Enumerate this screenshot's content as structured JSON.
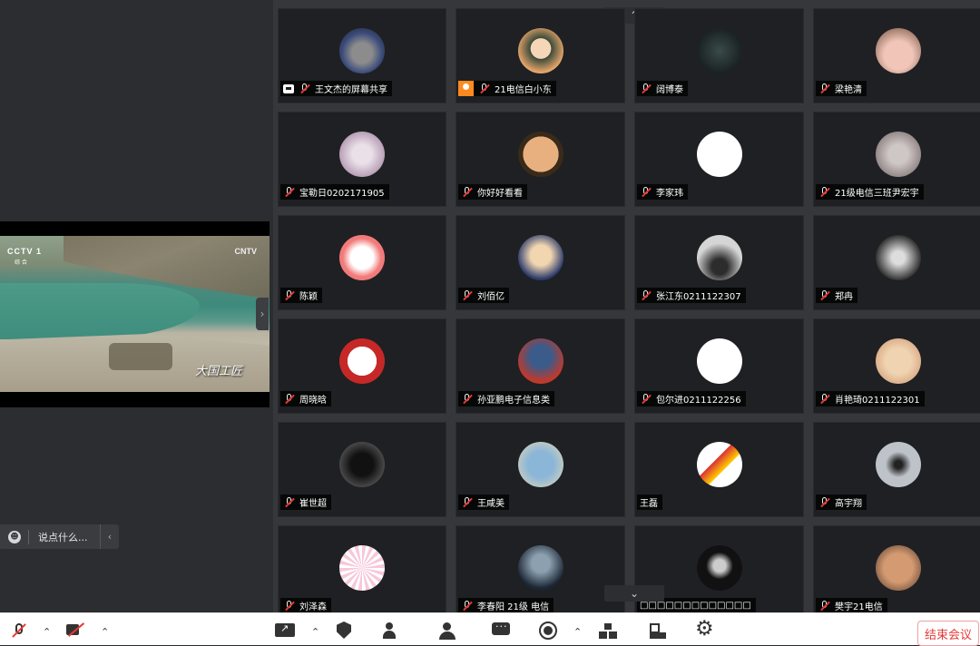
{
  "screen_share": {
    "channel_logo": "CCTV 1",
    "channel_sub": "综 合",
    "cntv_logo": "CNTV",
    "caption": "大国工匠"
  },
  "chat_input": {
    "placeholder": "说点什么..."
  },
  "participants": [
    {
      "name": "王文杰的屏幕共享",
      "indicator": "screen-share",
      "muted": true,
      "avatar": "cat"
    },
    {
      "name": "21电信白小东",
      "indicator": "camera-orange",
      "muted": true,
      "avatar": "boy"
    },
    {
      "name": "阔博泰",
      "indicator": "",
      "muted": true,
      "avatar": "dark"
    },
    {
      "name": "梁艳清",
      "indicator": "",
      "muted": true,
      "avatar": "baby"
    },
    {
      "name": "宝勒日0202171905",
      "indicator": "",
      "muted": true,
      "avatar": "girl"
    },
    {
      "name": "你好好看看",
      "indicator": "",
      "muted": true,
      "avatar": "face"
    },
    {
      "name": "李家玮",
      "indicator": "",
      "muted": true,
      "avatar": "line"
    },
    {
      "name": "21级电信三班尹宏宇",
      "indicator": "",
      "muted": true,
      "avatar": "grey"
    },
    {
      "name": "陈颖",
      "indicator": "",
      "muted": true,
      "avatar": "panda"
    },
    {
      "name": "刘佰亿",
      "indicator": "",
      "muted": true,
      "avatar": "anime"
    },
    {
      "name": "张江东0211122307",
      "indicator": "",
      "muted": true,
      "avatar": "birds"
    },
    {
      "name": "郑冉",
      "indicator": "",
      "muted": true,
      "avatar": "bw"
    },
    {
      "name": "周晓晗",
      "indicator": "",
      "muted": true,
      "avatar": "red"
    },
    {
      "name": "孙亚鹏电子信息类",
      "indicator": "",
      "muted": true,
      "avatar": "flower"
    },
    {
      "name": "包尔进0211122256",
      "indicator": "",
      "muted": true,
      "avatar": "white"
    },
    {
      "name": "肖艳琦0211122301",
      "indicator": "",
      "muted": true,
      "avatar": "beige"
    },
    {
      "name": "崔世超",
      "indicator": "",
      "muted": true,
      "avatar": "shadow"
    },
    {
      "name": "王咸美",
      "indicator": "",
      "muted": true,
      "avatar": "sky"
    },
    {
      "name": "王磊",
      "indicator": "",
      "muted": false,
      "avatar": "collage"
    },
    {
      "name": "高宇翔",
      "indicator": "",
      "muted": true,
      "avatar": "silhouette"
    },
    {
      "name": "刘泽森",
      "indicator": "",
      "muted": true,
      "avatar": "pink"
    },
    {
      "name": "李春阳 21级 电信",
      "indicator": "",
      "muted": true,
      "avatar": "knight"
    },
    {
      "name": "□□□□□□□□□□□□□",
      "indicator": "",
      "muted": false,
      "avatar": "mask"
    },
    {
      "name": "樊宇21电信",
      "indicator": "",
      "muted": true,
      "avatar": "man"
    }
  ],
  "toolbar": {
    "items": [
      {
        "name": "mute-button",
        "icon": "mic-off-icon",
        "caret": true
      },
      {
        "name": "video-button",
        "icon": "camera-off-icon",
        "caret": true
      },
      {
        "name": "share-screen-button",
        "icon": "share-screen-icon",
        "caret": true
      },
      {
        "name": "security-button",
        "icon": "shield-icon",
        "caret": false
      },
      {
        "name": "invite-button",
        "icon": "add-user-icon",
        "caret": false
      },
      {
        "name": "members-button",
        "icon": "members-icon",
        "caret": false
      },
      {
        "name": "chat-button",
        "icon": "chat-icon",
        "caret": false
      },
      {
        "name": "record-button",
        "icon": "record-icon",
        "caret": true
      },
      {
        "name": "layout-button",
        "icon": "layout-icon",
        "caret": false
      },
      {
        "name": "apps-button",
        "icon": "apps-icon",
        "caret": false
      },
      {
        "name": "settings-button",
        "icon": "gear-icon",
        "caret": false
      }
    ],
    "end_meeting_label": "结束会议"
  },
  "colors": {
    "background": "#2b2d30",
    "tile": "#1f2023",
    "end_meeting": "#e53935",
    "mute_slash": "#e53935",
    "camera_indicator": "#ff8a1e"
  }
}
